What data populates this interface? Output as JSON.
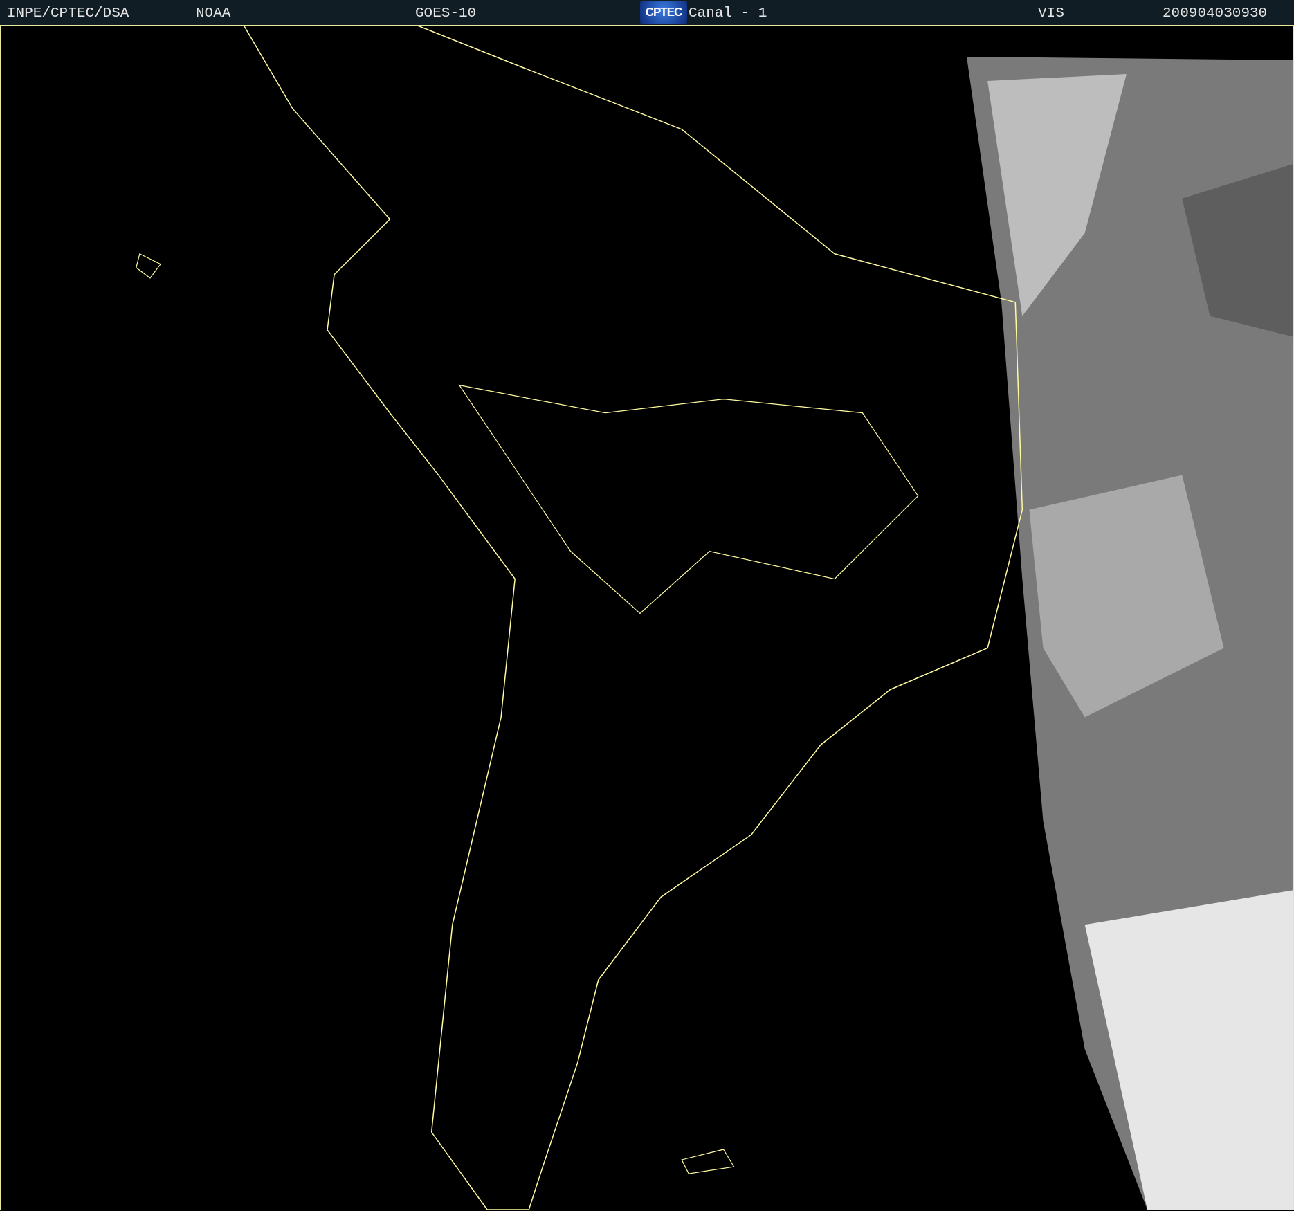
{
  "header": {
    "items": [
      {
        "kind": "text",
        "text": "INPE/CPTEC/DSA"
      },
      {
        "kind": "text",
        "text": "NOAA"
      },
      {
        "kind": "text",
        "text": "GOES-10"
      },
      {
        "kind": "logo",
        "text": "CPTEC"
      },
      {
        "kind": "text",
        "text": "Canal - 1"
      },
      {
        "kind": "text",
        "text": "VIS"
      },
      {
        "kind": "text",
        "text": "200904030930"
      }
    ]
  }
}
